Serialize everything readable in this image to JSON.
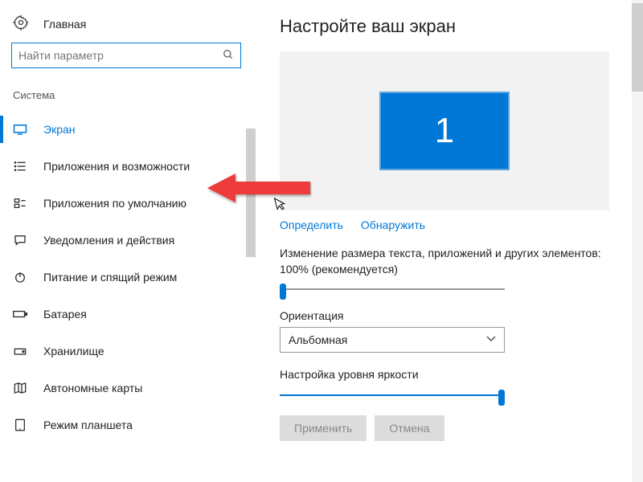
{
  "home_label": "Главная",
  "search_placeholder": "Найти параметр",
  "section_label": "Система",
  "nav": [
    {
      "label": "Экран"
    },
    {
      "label": "Приложения и возможности"
    },
    {
      "label": "Приложения по умолчанию"
    },
    {
      "label": "Уведомления и действия"
    },
    {
      "label": "Питание и спящий режим"
    },
    {
      "label": "Батарея"
    },
    {
      "label": "Хранилище"
    },
    {
      "label": "Автономные карты"
    },
    {
      "label": "Режим планшета"
    }
  ],
  "main": {
    "title": "Настройте ваш экран",
    "monitor_number": "1",
    "link_identify": "Определить",
    "link_detect": "Обнаружить",
    "scaling_text": "Изменение размера текста, приложений и других элементов: 100% (рекомендуется)",
    "orientation_label": "Ориентация",
    "orientation_value": "Альбомная",
    "brightness_label": "Настройка уровня яркости",
    "btn_apply": "Применить",
    "btn_cancel": "Отмена"
  }
}
